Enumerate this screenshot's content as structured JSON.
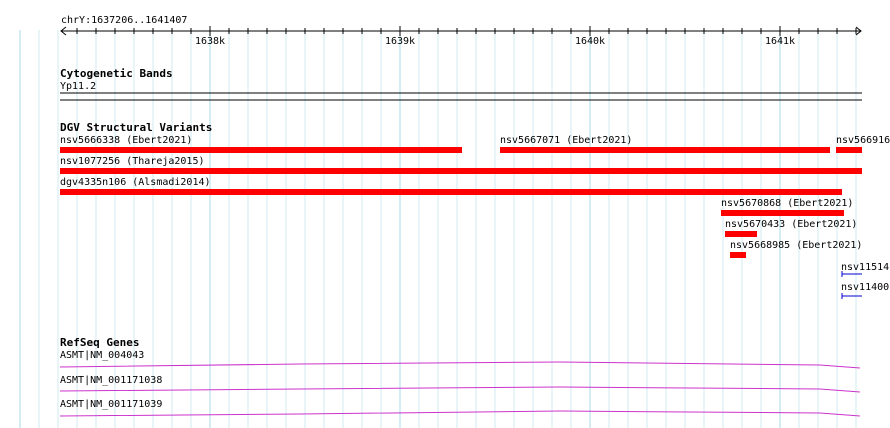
{
  "ruler": {
    "region": "chrY:1637206..1641407",
    "ticks": [
      "1638k",
      "1639k",
      "1640k",
      "1641k"
    ]
  },
  "tracks": {
    "cytoband": {
      "title": "Cytogenetic Bands",
      "band": "Yp11.2"
    },
    "dgv": {
      "title": "DGV Structural Variants",
      "feature_color": "#ff0000",
      "features": [
        {
          "label": "nsv5666338 (Ebert2021)"
        },
        {
          "label": "nsv5667071 (Ebert2021)"
        },
        {
          "label": "nsv566916"
        },
        {
          "label": "nsv1077256 (Thareja2015)"
        },
        {
          "label": "dgv4335n106 (Alsmadi2014)"
        },
        {
          "label": "nsv5670868 (Ebert2021)"
        },
        {
          "label": "nsv5670433 (Ebert2021)"
        },
        {
          "label": "nsv5668985 (Ebert2021)"
        },
        {
          "label": "nsv11514"
        },
        {
          "label": "nsv11400"
        }
      ]
    },
    "refseq": {
      "title": "RefSeq Genes",
      "gene_color": "#cc33cc",
      "genes": [
        {
          "label": "ASMT|NM_004043"
        },
        {
          "label": "ASMT|NM_001171038"
        },
        {
          "label": "ASMT|NM_001171039"
        }
      ]
    }
  }
}
